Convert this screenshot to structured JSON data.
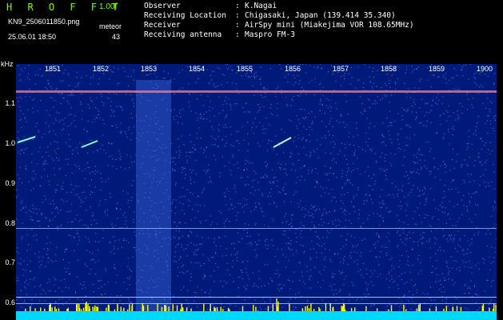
{
  "header": {
    "app_title": "H R O F F T",
    "version": "1.00f",
    "filename": "KN9_2506011850.png",
    "mode": "meteor",
    "datetime": "25.06.01 18:50",
    "count": "43"
  },
  "info": [
    {
      "key": "Observer",
      "sep": ":",
      "value": "K.Nagai"
    },
    {
      "key": "Receiving Location",
      "sep": ":",
      "value": "Chigasaki, Japan (139.414 35.340)"
    },
    {
      "key": "Receiver",
      "sep": ":",
      "value": "AirSpy mini (Miakejima VOR 108.65MHz)"
    },
    {
      "key": "Receiving antenna",
      "sep": ":",
      "value": "Maspro FM-3"
    }
  ],
  "axis": {
    "unit": "kHz",
    "y_ticks": [
      "1.1",
      "1.0",
      "0.9",
      "0.8",
      "0.7",
      "0.6"
    ],
    "x_ticks": [
      "1851",
      "1852",
      "1853",
      "1854",
      "1855",
      "1856",
      "1857",
      "1858",
      "1859",
      "1900"
    ]
  },
  "colors": {
    "background": "#000000",
    "spectrum": "#001a7a",
    "title": "#7CFC00",
    "carrier": "#ff6a6a",
    "baseline": "#ffff00",
    "floor": "#00d8ff"
  }
}
